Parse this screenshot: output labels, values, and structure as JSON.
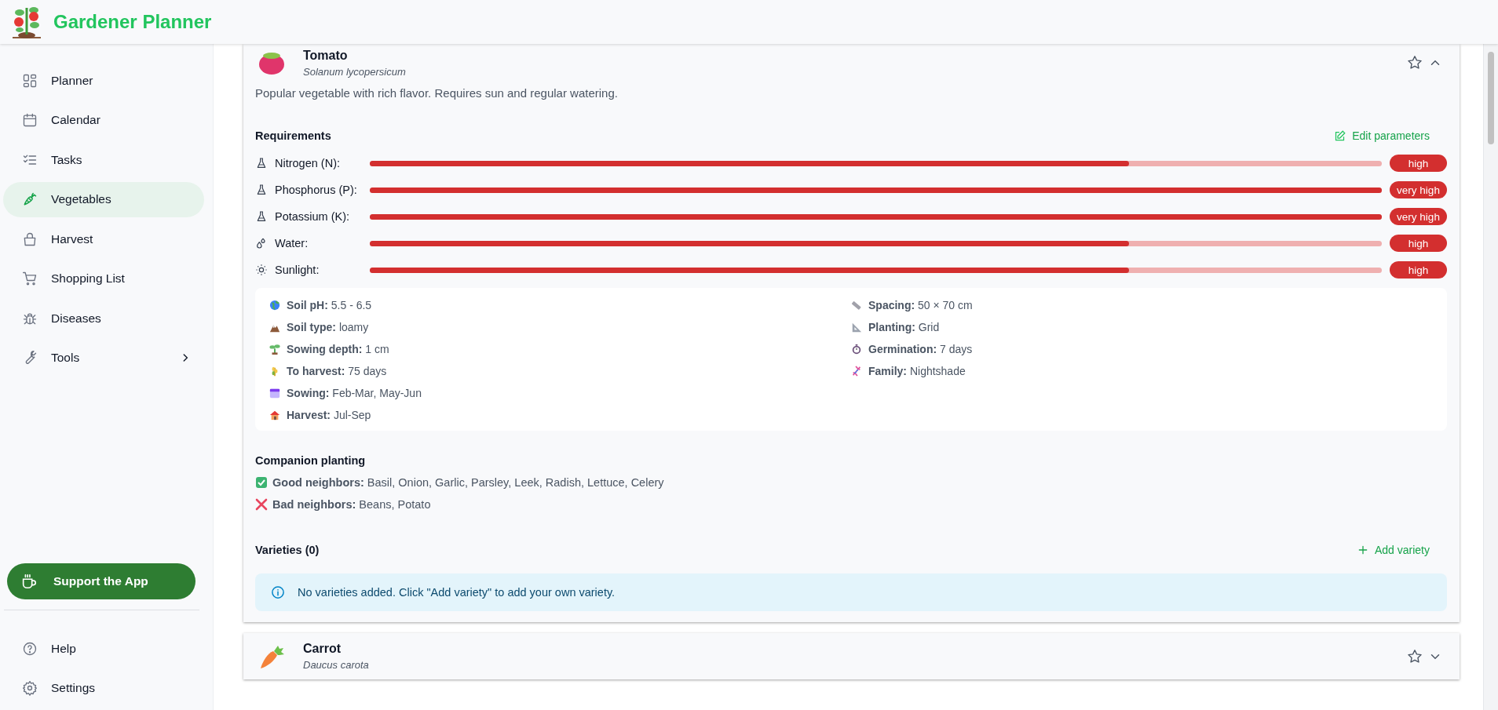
{
  "app": {
    "title": "Gardener Planner"
  },
  "nav": [
    {
      "label": "Planner",
      "selected": false,
      "has_submenu": false
    },
    {
      "label": "Calendar",
      "selected": false,
      "has_submenu": false
    },
    {
      "label": "Tasks",
      "selected": false,
      "has_submenu": false
    },
    {
      "label": "Vegetables",
      "selected": true,
      "has_submenu": false
    },
    {
      "label": "Harvest",
      "selected": false,
      "has_submenu": false
    },
    {
      "label": "Shopping List",
      "selected": false,
      "has_submenu": false
    },
    {
      "label": "Diseases",
      "selected": false,
      "has_submenu": false
    },
    {
      "label": "Tools",
      "selected": false,
      "has_submenu": true
    }
  ],
  "support_button": {
    "label": "Support the App"
  },
  "footer_nav": [
    {
      "label": "Help"
    },
    {
      "label": "Settings"
    }
  ],
  "vegetables": [
    {
      "name": "Tomato",
      "latin": "Solanum lycopersicum",
      "favorite": false,
      "expanded": true,
      "description": "Popular vegetable with rich flavor. Requires sun and regular watering.",
      "requirements_title": "Requirements",
      "edit_label": "Edit parameters",
      "requirements": [
        {
          "label": "Nitrogen (N):",
          "level": 0.75,
          "rating": "high"
        },
        {
          "label": "Phosphorus (P):",
          "level": 1,
          "rating": "very high"
        },
        {
          "label": "Potassium (K):",
          "level": 1,
          "rating": "very high"
        },
        {
          "label": "Water:",
          "level": 0.75,
          "rating": "high"
        },
        {
          "label": "Sunlight:",
          "level": 0.75,
          "rating": "high"
        }
      ],
      "facts_left": [
        {
          "label": "Soil pH:",
          "value": "5.5 - 6.5"
        },
        {
          "label": "Soil type:",
          "value": "loamy"
        },
        {
          "label": "Sowing depth:",
          "value": "1 cm"
        },
        {
          "label": "To harvest:",
          "value": "75 days"
        },
        {
          "label": "Sowing:",
          "value": "Feb-Mar, May-Jun"
        },
        {
          "label": "Harvest:",
          "value": "Jul-Sep"
        }
      ],
      "facts_right": [
        {
          "label": "Spacing:",
          "value": "50 × 70 cm"
        },
        {
          "label": "Planting:",
          "value": "Grid"
        },
        {
          "label": "Germination:",
          "value": "7 days"
        },
        {
          "label": "Family:",
          "value": "Nightshade"
        }
      ],
      "companion_title": "Companion planting",
      "neighbors": [
        {
          "kind": "good",
          "label": "Good neighbors:",
          "value": "Basil, Onion, Garlic, Parsley, Leek, Radish, Lettuce, Celery"
        },
        {
          "kind": "bad",
          "label": "Bad neighbors:",
          "value": "Beans, Potato"
        }
      ],
      "varieties_title": "Varieties (0)",
      "add_variety_label": "Add variety",
      "notice": "No varieties added. Click \"Add variety\" to add your own variety."
    },
    {
      "name": "Carrot",
      "latin": "Daucus carota",
      "favorite": false,
      "expanded": false
    }
  ]
}
